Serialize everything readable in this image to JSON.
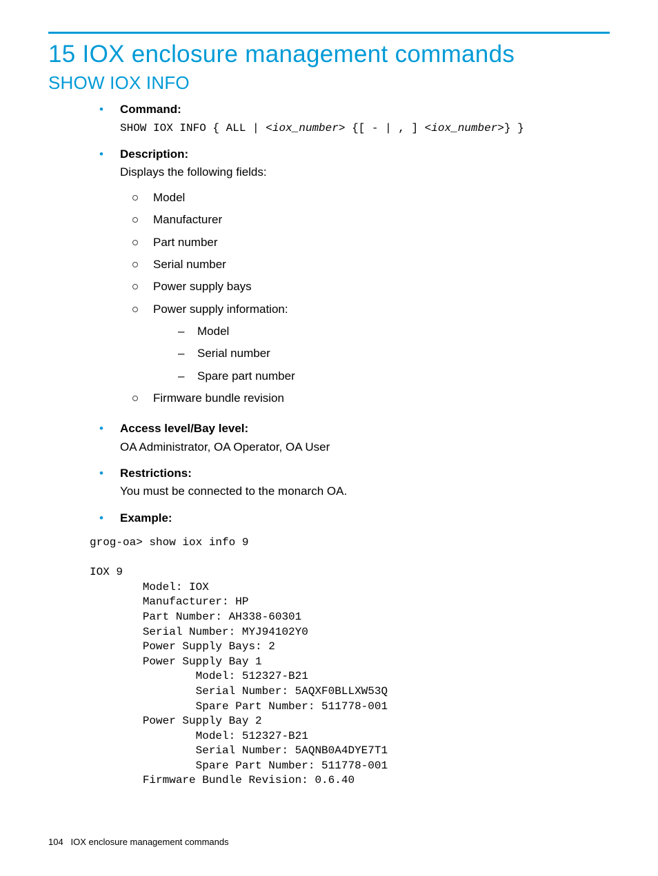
{
  "chapter_title": "15 IOX enclosure management commands",
  "section_title": "SHOW IOX INFO",
  "items": {
    "command": {
      "label": "Command:",
      "prefix": "SHOW IOX INFO  { ALL | <",
      "arg1": "iox_number",
      "mid": "> {[ - | , ] <",
      "arg2": "iox_number",
      "suffix": ">} }"
    },
    "description": {
      "label": "Description:",
      "intro": "Displays the following fields:",
      "fields": [
        "Model",
        "Manufacturer",
        "Part number",
        "Serial number",
        "Power supply bays"
      ],
      "psi_label": "Power supply information:",
      "psi_sub": [
        "Model",
        "Serial number",
        "Spare part number"
      ],
      "last": "Firmware bundle revision"
    },
    "access": {
      "label": "Access level/Bay level:",
      "text": "OA Administrator, OA Operator, OA User"
    },
    "restrictions": {
      "label": "Restrictions:",
      "text": "You must be connected to the monarch OA."
    },
    "example": {
      "label": "Example:",
      "text": "grog-oa> show iox info 9\n\nIOX 9\n        Model: IOX\n        Manufacturer: HP\n        Part Number: AH338-60301\n        Serial Number: MYJ94102Y0\n        Power Supply Bays: 2\n        Power Supply Bay 1\n                Model: 512327-B21\n                Serial Number: 5AQXF0BLLXW53Q\n                Spare Part Number: 511778-001\n        Power Supply Bay 2\n                Model: 512327-B21\n                Serial Number: 5AQNB0A4DYE7T1\n                Spare Part Number: 511778-001\n        Firmware Bundle Revision: 0.6.40"
    }
  },
  "footer": {
    "page": "104",
    "text": "IOX enclosure management commands"
  }
}
